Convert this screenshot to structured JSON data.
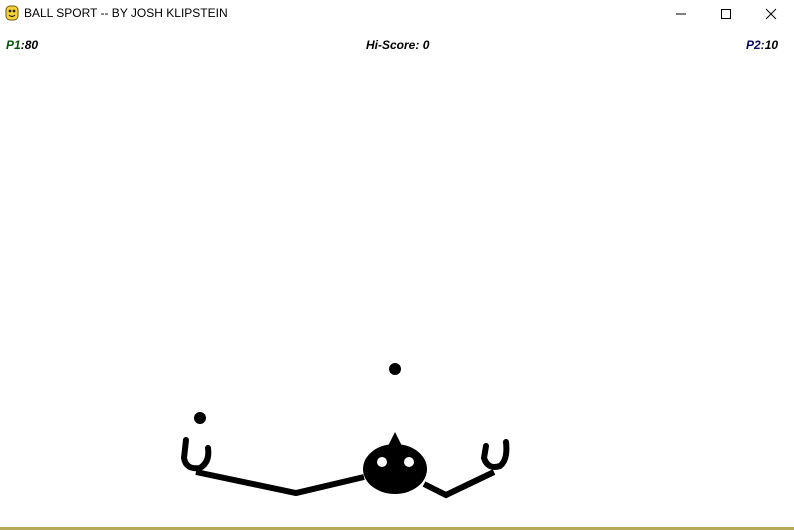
{
  "window": {
    "title": "BALL SPORT -- BY JOSH KLIPSTEIN",
    "icon": "pygame-snake-icon",
    "controls": [
      "minimize-icon",
      "maximize-icon",
      "close-icon"
    ]
  },
  "hud": {
    "p1_label": "P1",
    "p1_sep": ":",
    "p1_score": "80",
    "hiscore_label": "Hi-Score:",
    "hiscore_value": "0",
    "p2_label": "P2:",
    "p2_score": "10"
  },
  "colors": {
    "background": "#ffffff",
    "sprite": "#000000",
    "p1_label": "#0a4f0a",
    "p2_label": "#0a0a5a",
    "bottom_border": "#b5a95a"
  }
}
